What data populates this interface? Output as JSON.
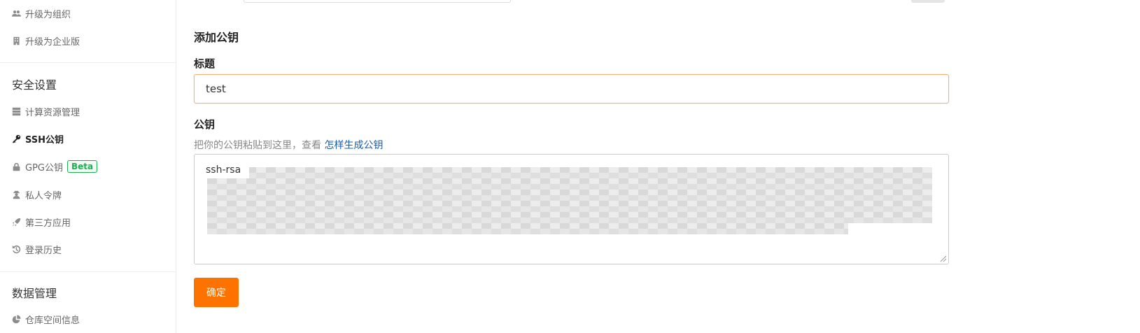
{
  "sidebar": {
    "org_items": [
      {
        "label": "升级为组织",
        "icon": "users-icon"
      },
      {
        "label": "升级为企业版",
        "icon": "building-icon"
      }
    ],
    "security_title": "安全设置",
    "security_items": [
      {
        "label": "计算资源管理",
        "icon": "server-icon"
      },
      {
        "label": "SSH公钥",
        "icon": "key-icon",
        "active": true
      },
      {
        "label": "GPG公钥",
        "icon": "lock-icon",
        "badge": "Beta"
      },
      {
        "label": "私人令牌",
        "icon": "user-secret-icon"
      },
      {
        "label": "第三方应用",
        "icon": "rocket-icon"
      },
      {
        "label": "登录历史",
        "icon": "history-icon"
      }
    ],
    "data_title": "数据管理",
    "data_items": [
      {
        "label": "仓库空间信息",
        "icon": "pie-chart-icon"
      }
    ]
  },
  "form": {
    "heading": "添加公钥",
    "title_label": "标题",
    "title_value": "test",
    "key_label": "公钥",
    "hint_text": "把你的公钥粘贴到这里，查看 ",
    "hint_link": "怎样生成公钥",
    "key_value": "ssh-rsa",
    "submit_label": "确定"
  },
  "colors": {
    "accent": "#fe7300",
    "focus_border": "#f5b27d",
    "link": "#1a5dab",
    "beta": "#1fae52"
  }
}
